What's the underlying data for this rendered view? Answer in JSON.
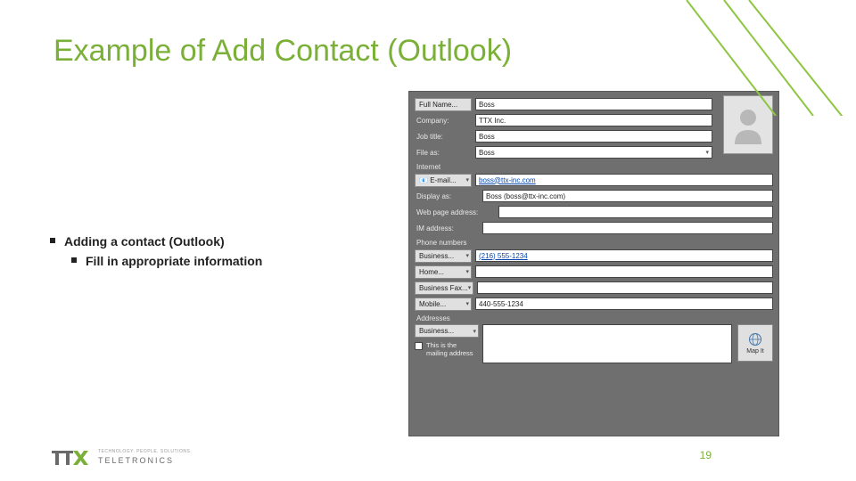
{
  "title": "Example of Add Contact (Outlook)",
  "bullets": {
    "outer": "Adding a contact (Outlook)",
    "inner": "Fill in appropriate information"
  },
  "page_number": "19",
  "branding": {
    "name": "TELETRONICS",
    "tagline": "TECHNOLOGY. PEOPLE. SOLUTIONS."
  },
  "dialog": {
    "full_name_btn": "Full Name...",
    "full_name_val": "Boss",
    "company_lbl": "Company:",
    "company_val": "TTX Inc.",
    "job_title_lbl": "Job title:",
    "job_title_val": "Boss",
    "file_as_lbl": "File as:",
    "file_as_val": "Boss",
    "section_internet": "Internet",
    "email_btn": "E-mail...",
    "email_val": "boss@ttx-inc.com",
    "display_as_lbl": "Display as:",
    "display_as_val": "Boss (boss@ttx-inc.com)",
    "web_lbl": "Web page address:",
    "web_val": "",
    "im_lbl": "IM address:",
    "im_val": "",
    "section_phone": "Phone numbers",
    "phone_business_btn": "Business...",
    "phone_business_val": "(216) 555-1234",
    "phone_home_btn": "Home...",
    "phone_home_val": "",
    "phone_bfax_btn": "Business Fax...",
    "phone_bfax_val": "",
    "phone_mobile_btn": "Mobile...",
    "phone_mobile_val": "440-555-1234",
    "section_addr": "Addresses",
    "addr_business_btn": "Business...",
    "addr_mailing": "This is the mailing address",
    "mapit": "Map It"
  }
}
